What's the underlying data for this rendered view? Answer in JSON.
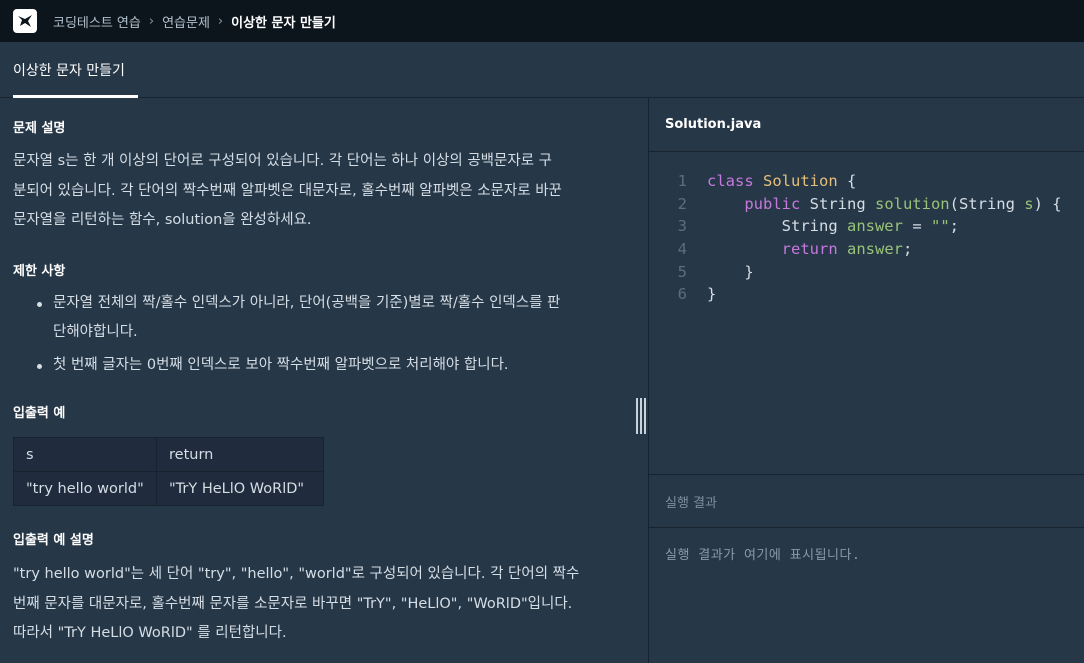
{
  "nav": {
    "crumbs": [
      "코딩테스트 연습",
      "연습문제",
      "이상한 문자 만들기"
    ]
  },
  "title": "이상한 문자 만들기",
  "problem": {
    "desc_heading": "문제 설명",
    "desc_lines": [
      "문자열 s는 한 개 이상의 단어로 구성되어 있습니다. 각 단어는 하나 이상의 공백문자로 구",
      "분되어 있습니다. 각 단어의 짝수번째 알파벳은 대문자로, 홀수번째 알파벳은 소문자로 바꾼",
      "문자열을 리턴하는 함수, solution을 완성하세요."
    ],
    "constraints_heading": "제한 사항",
    "constraints": [
      {
        "lines": [
          "문자열 전체의 짝/홀수 인덱스가 아니라, 단어(공백을 기준)별로 짝/홀수 인덱스를 판",
          "단해야합니다."
        ]
      },
      {
        "lines": [
          "첫 번째 글자는 0번째 인덱스로 보아 짝수번째 알파벳으로 처리해야 합니다."
        ]
      }
    ],
    "io_heading": "입출력 예",
    "io_table": {
      "headers": [
        "s",
        "return"
      ],
      "rows": [
        [
          "\"try hello world\"",
          "\"TrY HeLlO WoRlD\""
        ]
      ]
    },
    "explain_heading": "입출력 예 설명",
    "explain_lines": [
      "\"try hello world\"는 세 단어 \"try\", \"hello\", \"world\"로 구성되어 있습니다. 각 단어의 짝수",
      "번째 문자를 대문자로, 홀수번째 문자를 소문자로 바꾸면 \"TrY\", \"HeLlO\", \"WoRlD\"입니다.",
      "따라서 \"TrY HeLlO WoRlD\" 를 리턴합니다."
    ]
  },
  "editor": {
    "filename": "Solution.java",
    "line_numbers": [
      "1",
      "2",
      "3",
      "4",
      "5",
      "6"
    ],
    "code": {
      "l1_kw": "class",
      "l1_cls": "Solution",
      "l1_rest": " {",
      "l2_kw": "public",
      "l2_type": " String ",
      "l2_fn": "solution",
      "l2_p1": "(String ",
      "l2_param": "s",
      "l2_p2": ") {",
      "l3_type": "String ",
      "l3_var": "answer",
      "l3_eq": " = ",
      "l3_str": "\"\"",
      "l3_end": ";",
      "l4_kw": "return",
      "l4_sp": " ",
      "l4_var": "answer",
      "l4_end": ";",
      "l5": "}",
      "l6": "}"
    }
  },
  "result": {
    "heading": "실행 결과",
    "placeholder": "실행 결과가 여기에 표시됩니다."
  }
}
